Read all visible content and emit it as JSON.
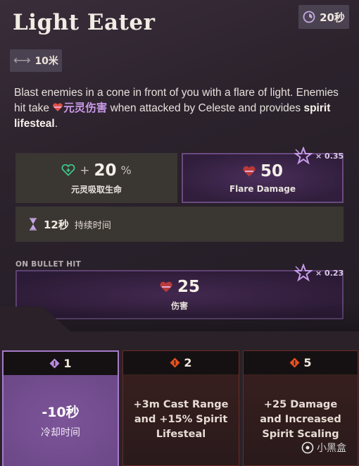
{
  "ability": {
    "title": "Light Eater",
    "cooldown": "20秒",
    "range": "10米"
  },
  "description": {
    "part1": "Blast enemies in a cone in front of you with a flare of light. Enemies hit take ",
    "spirit_damage": "元灵伤害",
    "part2": " when attacked by Celeste and provides ",
    "bold": "spirit lifesteal",
    "part3": "."
  },
  "stats": {
    "lifesteal": {
      "plus": "+",
      "value": "20",
      "unit": "%",
      "label": "元灵吸取生命"
    },
    "flare": {
      "value": "50",
      "label": "Flare Damage",
      "scale": "× 0.35"
    },
    "duration": {
      "value": "12秒",
      "label": "持续时间"
    }
  },
  "bullet_hit": {
    "heading": "ON BULLET HIT",
    "value": "25",
    "label": "伤害",
    "scale": "× 0.23"
  },
  "upgrades": [
    {
      "cost": "1",
      "big": "-10秒",
      "sub": "冷却时间"
    },
    {
      "cost": "2",
      "text": "+3m Cast Range and +15% Spirit Lifesteal"
    },
    {
      "cost": "5",
      "text": "+25 Damage and Increased Spirit Scaling"
    }
  ],
  "watermark": "小黑盒",
  "colors": {
    "spirit": "#c99ae8",
    "upgrade_active": "#8d63a8",
    "upgrade_locked_border": "#6b2a24",
    "accent_orange": "#e8501e"
  },
  "icons": [
    "cooldown-clock-icon",
    "range-arrows-icon",
    "spirit-heart-icon",
    "lifesteal-heart-icon",
    "spirit-star-icon",
    "hourglass-icon",
    "spirit-diamond-icon",
    "orange-diamond-icon"
  ]
}
